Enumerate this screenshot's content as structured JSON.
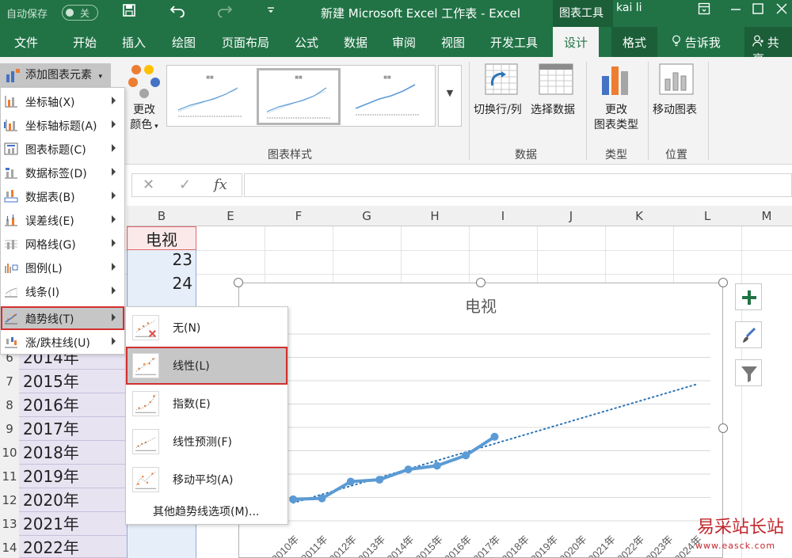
{
  "title_bar": {
    "autosave_label": "自动保存",
    "autosave_state": "关",
    "document_title": "新建 Microsoft Excel 工作表  -  Excel",
    "contextual_group": "图表工具",
    "user_name": "kai li"
  },
  "ribbon_tabs": [
    "文件",
    "开始",
    "插入",
    "绘图",
    "页面布局",
    "公式",
    "数据",
    "审阅",
    "视图",
    "开发工具",
    "设计",
    "格式",
    "告诉我",
    "共享"
  ],
  "active_tab": "设计",
  "ribbon": {
    "add_element_label": "添加图表元素",
    "change_colors_line1": "更改",
    "change_colors_line2": "颜色",
    "chart_styles_group": "图表样式",
    "switch_row_col": "切换行/列",
    "select_data": "选择数据",
    "data_group": "数据",
    "change_type_line1": "更改",
    "change_type_line2": "图表类型",
    "type_group": "类型",
    "move_chart": "移动图表",
    "location_group": "位置"
  },
  "formula_bar": {
    "fx_label": "fx",
    "value": ""
  },
  "columns": [
    "B",
    "E",
    "F",
    "G",
    "H",
    "I",
    "J",
    "K",
    "L",
    "M"
  ],
  "column_b": {
    "header": "电视",
    "values": [
      "23",
      "24"
    ]
  },
  "rows": [
    {
      "num": "6",
      "year": "2014年"
    },
    {
      "num": "7",
      "year": "2015年"
    },
    {
      "num": "8",
      "year": "2016年"
    },
    {
      "num": "9",
      "year": "2017年"
    },
    {
      "num": "10",
      "year": "2018年"
    },
    {
      "num": "11",
      "year": "2019年"
    },
    {
      "num": "12",
      "year": "2020年"
    },
    {
      "num": "13",
      "year": "2021年"
    },
    {
      "num": "14",
      "year": "2022年"
    }
  ],
  "element_menu": [
    {
      "label": "坐标轴(X)",
      "icon": "axes-icon"
    },
    {
      "label": "坐标轴标题(A)",
      "icon": "axis-title-icon"
    },
    {
      "label": "图表标题(C)",
      "icon": "chart-title-icon"
    },
    {
      "label": "数据标签(D)",
      "icon": "data-labels-icon"
    },
    {
      "label": "数据表(B)",
      "icon": "data-table-icon"
    },
    {
      "label": "误差线(E)",
      "icon": "error-bars-icon"
    },
    {
      "label": "网格线(G)",
      "icon": "gridlines-icon"
    },
    {
      "label": "图例(L)",
      "icon": "legend-icon"
    },
    {
      "label": "线条(I)",
      "icon": "lines-icon"
    },
    {
      "label": "趋势线(T)",
      "icon": "trendline-icon",
      "highlighted": true
    },
    {
      "label": "涨/跌柱线(U)",
      "icon": "up-down-bars-icon"
    }
  ],
  "trendline_menu": [
    {
      "label": "无(N)",
      "icon": "trendline-none-icon"
    },
    {
      "label": "线性(L)",
      "icon": "trendline-linear-icon",
      "highlighted": true
    },
    {
      "label": "指数(E)",
      "icon": "trendline-exponential-icon"
    },
    {
      "label": "线性预测(F)",
      "icon": "trendline-forecast-icon"
    },
    {
      "label": "移动平均(A)",
      "icon": "trendline-moving-average-icon"
    }
  ],
  "trendline_more": "其他趋势线选项(M)...",
  "colors": {
    "excel_green": "#217346",
    "series_blue": "#5b9bd5",
    "highlight_red": "#d32f2f"
  },
  "chart_data": {
    "type": "line",
    "title": "电视",
    "categories": [
      "2010年",
      "2011年",
      "2012年",
      "2013年",
      "2014年",
      "2015年",
      "2016年",
      "2017年",
      "2018年",
      "2019年",
      "2020年",
      "2021年",
      "2022年",
      "2023年",
      "2024年"
    ],
    "series": [
      {
        "values": [
          23,
          24,
          42,
          44,
          55,
          59,
          70,
          90
        ]
      }
    ],
    "trendline": {
      "type": "linear",
      "extends_to": "2024年"
    },
    "ylim": [
      0,
      200
    ],
    "grid": true
  },
  "watermark": {
    "text": "易采站长站",
    "url": "www.easck.com"
  }
}
